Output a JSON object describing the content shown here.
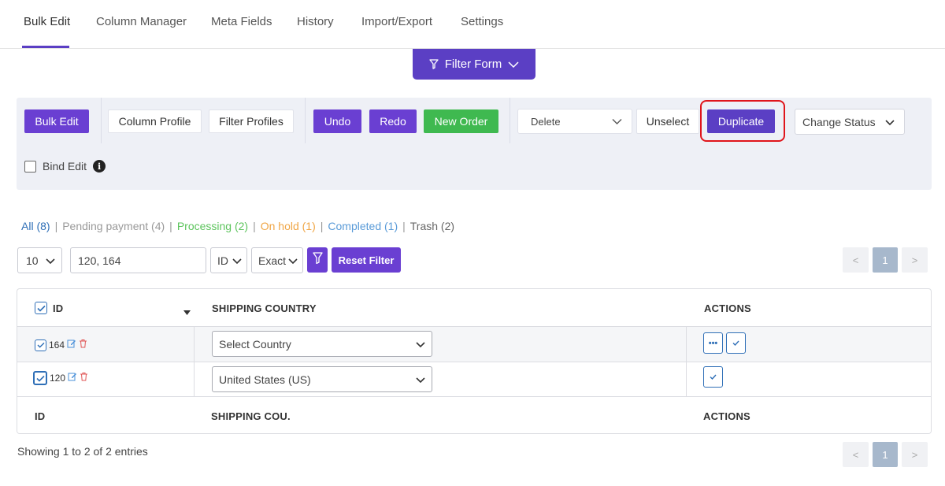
{
  "tabs": [
    {
      "label": "Bulk Edit",
      "active": true
    },
    {
      "label": "Column Manager"
    },
    {
      "label": "Meta Fields"
    },
    {
      "label": "History"
    },
    {
      "label": "Import/Export"
    },
    {
      "label": "Settings"
    }
  ],
  "filter_form": {
    "label": "Filter Form"
  },
  "toolbar": {
    "bulk_edit": "Bulk Edit",
    "column_profile": "Column Profile",
    "filter_profiles": "Filter Profiles",
    "undo": "Undo",
    "redo": "Redo",
    "new_order": "New Order",
    "delete_select": "Delete",
    "unselect": "Unselect",
    "duplicate": "Duplicate",
    "change_status": "Change Status",
    "bind_edit": "Bind Edit"
  },
  "status_links": [
    {
      "label": "All (8)",
      "color": "#2f6fb7"
    },
    {
      "label": "Pending payment (4)",
      "color": "#999999"
    },
    {
      "label": "Processing (2)",
      "color": "#5cc45c"
    },
    {
      "label": "On hold (1)",
      "color": "#f0a646"
    },
    {
      "label": "Completed (1)",
      "color": "#5a9bd8"
    },
    {
      "label": "Trash (2)",
      "color": "#666666"
    }
  ],
  "filter_row": {
    "per_page": "10",
    "search_value": "120, 164",
    "field": "ID",
    "match": "Exact",
    "reset": "Reset Filter"
  },
  "pager": {
    "prev": "<",
    "current": "1",
    "next": ">"
  },
  "table": {
    "headers": {
      "id": "ID",
      "shipping_country": "SHIPPING COUNTRY",
      "actions": "ACTIONS"
    },
    "rows": [
      {
        "id": "164",
        "country": "Select Country"
      },
      {
        "id": "120",
        "country": "United States (US)"
      }
    ],
    "footers": {
      "id": "ID",
      "shipping_country": "SHIPPING COU.",
      "actions": "ACTIONS"
    }
  },
  "showing": "Showing 1 to 2 of 2 entries",
  "colors": {
    "accent": "#5b3fc4",
    "green": "#3fb950",
    "highlight": "#e0151b"
  }
}
